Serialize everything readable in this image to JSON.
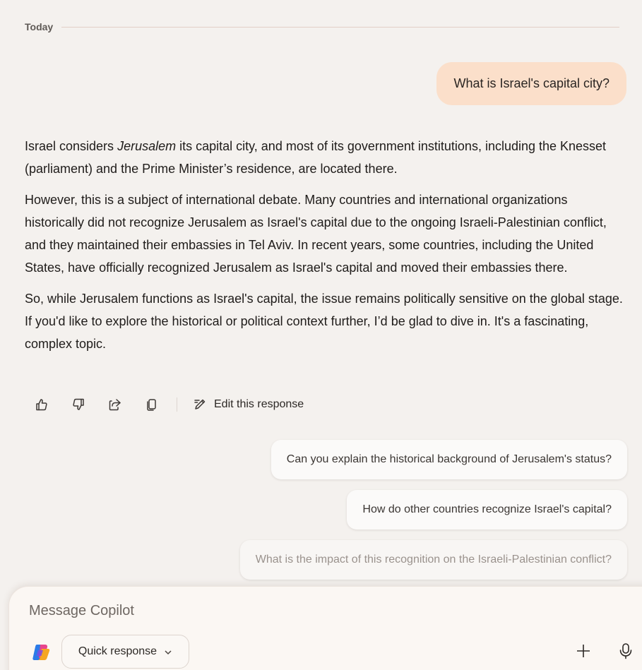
{
  "conversation": {
    "date_label": "Today",
    "user_message": "What is Israel's capital city?",
    "response": {
      "p1_before": "Israel considers ",
      "p1_emphasis": "Jerusalem",
      "p1_after": " its capital city, and most of its government institutions, including the Knesset (parliament) and the Prime Minister’s residence, are located there.",
      "p2": "However, this is a subject of international debate. Many countries and international organizations historically did not recognize Jerusalem as Israel's capital due to the ongoing Israeli-Palestinian conflict, and they maintained their embassies in Tel Aviv. In recent years, some countries, including the United States, have officially recognized Jerusalem as Israel's capital and moved their embassies there.",
      "p3": "So, while Jerusalem functions as Israel's capital, the issue remains politically sensitive on the global stage. If you'd like to explore the historical or political context further, I’d be glad to dive in. It's a fascinating, complex topic."
    }
  },
  "actions": {
    "icons": [
      "thumbs-up-icon",
      "thumbs-down-icon",
      "share-icon",
      "copy-icon"
    ],
    "edit_label": "Edit this response"
  },
  "suggestions": [
    "Can you explain the historical background of Jerusalem's status?",
    "How do other countries recognize Israel's capital?",
    "What is the impact of this recognition on the Israeli-Palestinian conflict?"
  ],
  "composer": {
    "placeholder": "Message Copilot",
    "mode_label": "Quick response"
  },
  "colors": {
    "background": "#f4f1ee",
    "user_bubble": "#fbdfca",
    "suggestion_bg": "#fbfaf9"
  }
}
